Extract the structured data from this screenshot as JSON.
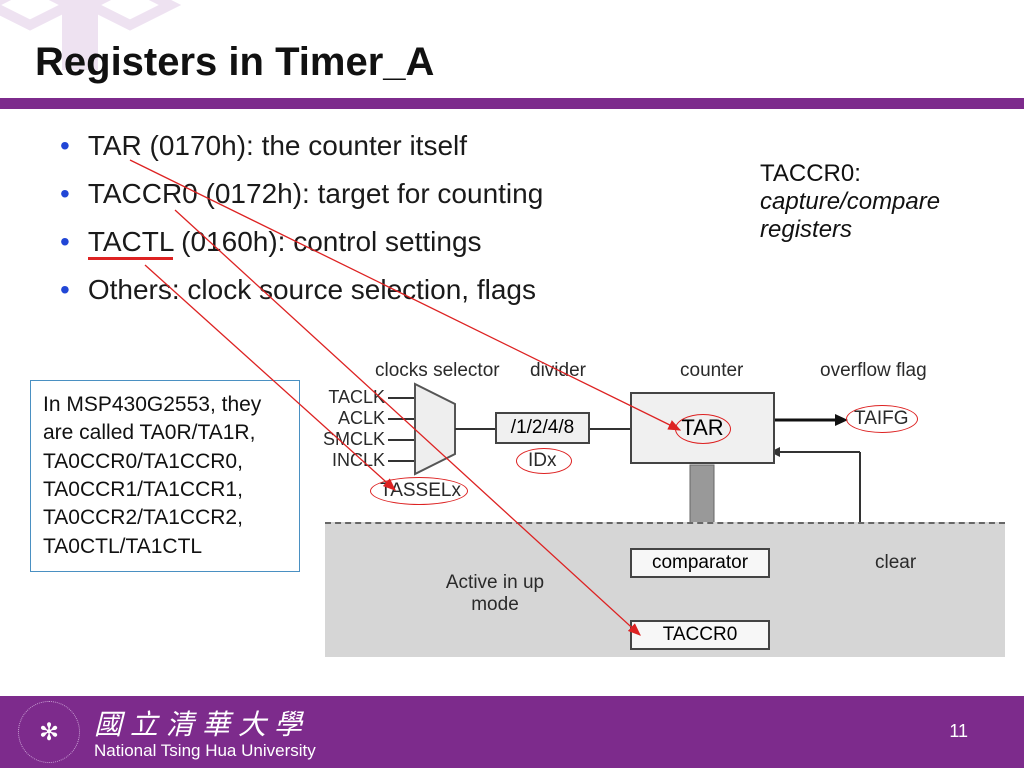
{
  "title": "Registers in Timer_A",
  "bullets": [
    "TAR (0170h): the counter itself",
    "TACCR0 (0172h): target for counting",
    "TACTL (0160h): control settings",
    "Others: clock source selection, flags"
  ],
  "tactl_underline_word": "TACTL",
  "side_note": {
    "line1": "TACCR0:",
    "line2": "capture/compare registers"
  },
  "msp_box": "In MSP430G2553, they are called TA0R/TA1R, TA0CCR0/TA1CCR0, TA0CCR1/TA1CCR1, TA0CCR2/TA1CCR2, TA0CTL/TA1CTL",
  "diagram": {
    "headers": {
      "clocks_selector": "clocks  selector",
      "divider": "divider",
      "counter": "counter",
      "overflow_flag": "overflow flag"
    },
    "clock_inputs": [
      "TACLK",
      "ACLK",
      "SMCLK",
      "INCLK"
    ],
    "divider_box": "/1/2/4/8",
    "divider_field": "IDx",
    "selector_field": "TASSELx",
    "counter_box": "TAR",
    "overflow_label": "TAIFG",
    "comparator_box": "comparator",
    "taccr0_box": "TACCR0",
    "active_mode": "Active in up mode",
    "clear_label": "clear"
  },
  "footer": {
    "chinese": "國立清華大學",
    "english": "National Tsing Hua University",
    "page": "11"
  }
}
